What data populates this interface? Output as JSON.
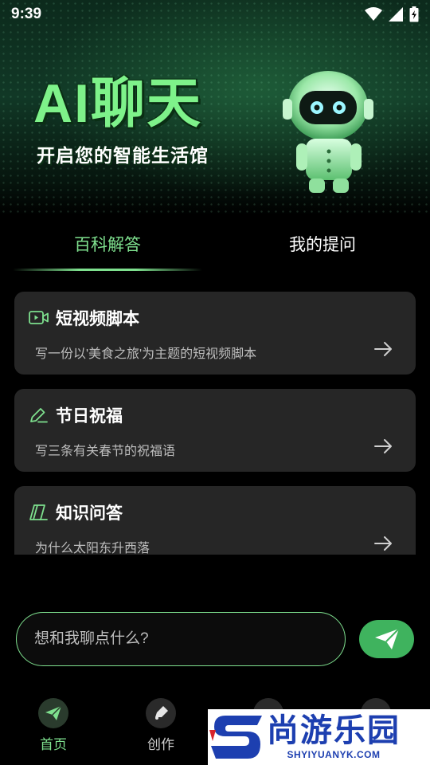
{
  "status_bar": {
    "time": "9:39"
  },
  "hero": {
    "title": "AI聊天",
    "subtitle": "开启您的智能生活馆"
  },
  "tabs": [
    {
      "label": "百科解答",
      "active": true
    },
    {
      "label": "我的提问",
      "active": false
    }
  ],
  "cards": [
    {
      "icon": "video-icon",
      "title": "短视频脚本",
      "description": "写一份以'美食之旅'为主题的短视频脚本"
    },
    {
      "icon": "pencil-icon",
      "title": "节日祝福",
      "description": "写三条有关春节的祝福语"
    },
    {
      "icon": "book-icon",
      "title": "知识问答",
      "description": "为什么太阳东升西落"
    }
  ],
  "input": {
    "placeholder": "想和我聊点什么?",
    "value": ""
  },
  "bottom_nav": [
    {
      "label": "首页",
      "icon": "paper-plane-icon",
      "active": true
    },
    {
      "label": "创作",
      "icon": "pen-icon",
      "active": false
    }
  ],
  "watermark": {
    "text_cn": "尚游乐园",
    "text_en": "SHYIYUANYK.COM"
  },
  "colors": {
    "accent": "#7ee08e",
    "send_button": "#3fb35e",
    "card_bg": "#262626",
    "background": "#000000"
  }
}
